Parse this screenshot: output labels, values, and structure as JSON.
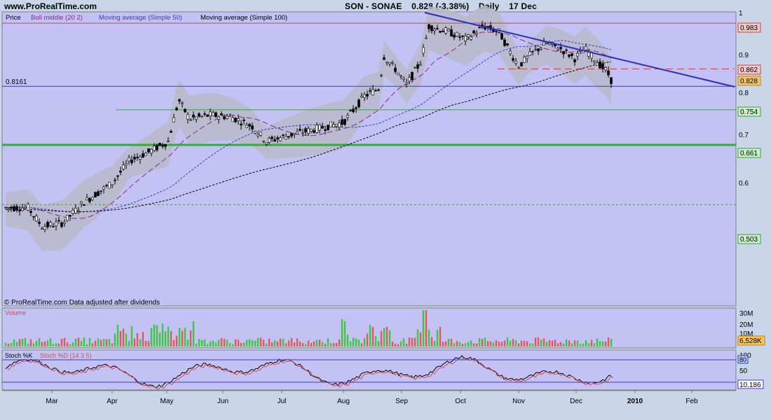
{
  "header": {
    "site": "www.ProRealTime.com",
    "symbol": "SON - SONAE",
    "last": "0.828 (-3.38%)",
    "period": "Daily",
    "date": "17 Dec"
  },
  "price_panel": {
    "legend": [
      {
        "label": "Price",
        "color": "#000000"
      },
      {
        "label": "Boll middle (20 2)",
        "color": "#8b2a8b"
      },
      {
        "label": "Moving average (Simple 50)",
        "color": "#3b3bd0"
      },
      {
        "label": "Moving average (Simple 100)",
        "color": "#000000"
      }
    ],
    "left_level_label": "0.8161",
    "footer_note": "© ProRealTime.com Data adjusted after dividends",
    "axis_ticks": [
      "0.9",
      "0.8",
      "0.7",
      "0.6"
    ],
    "axis_top": "1",
    "badges": [
      {
        "text": "0.983",
        "bg": "#f2c8c8",
        "border": "#d04040"
      },
      {
        "text": "0.862",
        "bg": "#f2c8c8",
        "border": "#d04040"
      },
      {
        "text": "0.828",
        "bg": "#f6c65a",
        "border": "#c08020"
      },
      {
        "text": "0.754",
        "bg": "#c8f0c8",
        "border": "#40a040"
      },
      {
        "text": "0.661",
        "bg": "#c8f0c8",
        "border": "#40a040"
      },
      {
        "text": "0.503",
        "bg": "#c8f0c8",
        "border": "#40a040"
      }
    ]
  },
  "volume_panel": {
    "label": "Volume",
    "axis_ticks": [
      "30M",
      "20M",
      "10M"
    ],
    "badge": "6,528K"
  },
  "stoch_panel": {
    "label_k": "Stoch %K",
    "label_d": "Stoch %D (14 3 5)",
    "axis_ticks": [
      "100",
      "50"
    ],
    "badge_upper": "80",
    "badge_value": "10.186"
  },
  "x_axis": {
    "labels": [
      "Mar",
      "Apr",
      "May",
      "Jun",
      "Jul",
      "Aug",
      "Sep",
      "Oct",
      "Nov",
      "Dec",
      "2010",
      "Feb"
    ]
  },
  "chart_data": {
    "type": "line",
    "title": "SON - SONAE Daily",
    "price_levels": {
      "resistance_1": 0.983,
      "resistance_2": 0.862,
      "last_close": 0.828,
      "support_1": 0.754,
      "support_2": 0.661,
      "support_3": 0.503,
      "reference": 0.8161
    },
    "price_path": {
      "months": [
        "Feb",
        "Mar",
        "Apr",
        "May",
        "Jun",
        "Jul",
        "Aug",
        "Sep",
        "Oct",
        "Nov",
        "Dec"
      ],
      "approx_close": [
        0.49,
        0.47,
        0.6,
        0.73,
        0.72,
        0.69,
        0.73,
        0.96,
        0.96,
        0.9,
        0.83
      ]
    },
    "volume_scale": "M",
    "stochastic": {
      "upper": 80,
      "lower": 20,
      "last": 10.186
    }
  }
}
